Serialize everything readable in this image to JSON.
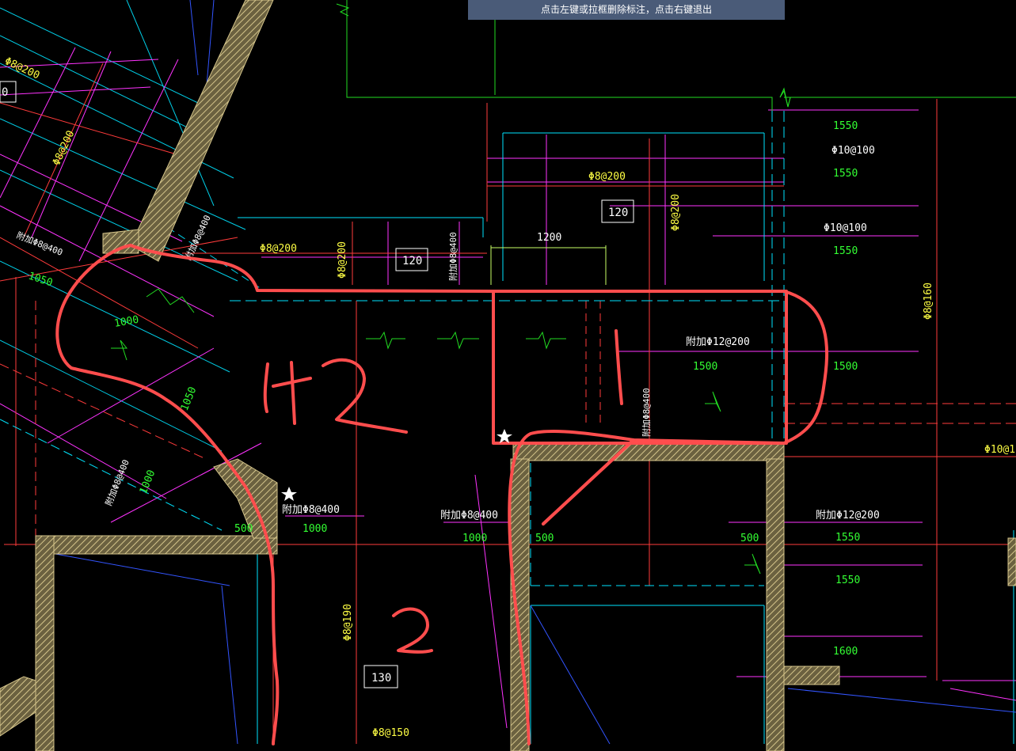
{
  "status_bar": {
    "hint": "点击左键或拉框删除标注，点击右键退出"
  },
  "section_tags": [
    "0",
    "120",
    "120",
    "130"
  ],
  "rebar_labels": {
    "yellow": [
      "Φ8@200",
      "Φ8@200",
      "Φ8@200",
      "Φ8@200",
      "Φ8@200",
      "Φ8@200",
      "Φ8@190",
      "Φ8@150",
      "Φ8@160",
      "Φ10@1"
    ],
    "green": [
      "1550",
      "1550",
      "1550",
      "1500",
      "1500",
      "1550",
      "1550",
      "1600",
      "1050",
      "1000",
      "1050",
      "1000",
      "500",
      "1000",
      "1000",
      "500",
      "500"
    ],
    "white": [
      "Φ10@100",
      "Φ10@100",
      "1200",
      "附加Φ12@200",
      "附加Φ12@200",
      "附加Φ8@400",
      "附加Φ8@400"
    ],
    "rotated": [
      "附加Φ8@400",
      "附加Φ8@400",
      "附加Φ8@400",
      "附加Φ8@400",
      "附加Φ8@400"
    ]
  },
  "handwritten_marks": [
    "1+2",
    "1",
    "2"
  ],
  "colors": {
    "background": "#000000",
    "red_lines": "#ff3b3b",
    "magenta_lines": "#ff33ff",
    "cyan_lines": "#00e5ff",
    "green_lines": "#22dd22",
    "yellow_text": "#ffff44",
    "wall_hatch": "#b8a86a",
    "annotation": "#ff4d4d",
    "hint_bar": "#4a5b78"
  },
  "icons": [
    "star-marker-icon",
    "break-symbol-icon"
  ]
}
